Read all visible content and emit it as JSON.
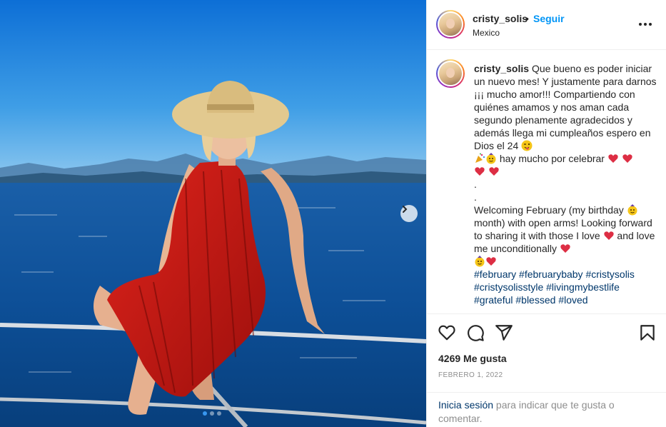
{
  "post": {
    "username": "cristy_solis",
    "separator": "•",
    "follow_label": "Seguir",
    "location": "Mexico",
    "caption": {
      "username": "cristy_solis",
      "line1": " Que bueno es poder iniciar un nuevo mes! Y justamente para darnos ¡¡¡ mucho amor!!! Compartiendo con quiénes amamos y nos aman cada segundo plenamente agradecidos y además llega mi cumpleaños espero en Dios el 24 ",
      "line2": " hay mucho por celebrar ",
      "dot1": ".",
      "dot2": ".",
      "line3": "Welcoming February (my birthday ",
      "line4": " month) with open arms! Looking forward to sharing it with those I love ",
      "line5": " and love me unconditionally ",
      "hashtags": [
        "#february",
        "#februarybaby",
        "#cristysolis",
        "#cristysolisstyle",
        "#livingmybestlife",
        "#grateful",
        "#blessed",
        "#loved"
      ]
    },
    "likes": "4269 Me gusta",
    "date": "FEBRERO 1, 2022",
    "login_link": "Inicia sesión",
    "login_rest": " para indicar que te gusta o comentar."
  },
  "carousel": {
    "slide_count": 3,
    "active_index": 0
  },
  "icons": {
    "more": "more-options-icon",
    "like": "heart-icon",
    "comment": "comment-icon",
    "share": "send-icon",
    "save": "bookmark-icon",
    "next": "chevron-right-icon"
  },
  "colors": {
    "accent": "#0095f6",
    "hashtag": "#00376b",
    "heart": "#ed4956",
    "muted": "#8e8e8e"
  }
}
